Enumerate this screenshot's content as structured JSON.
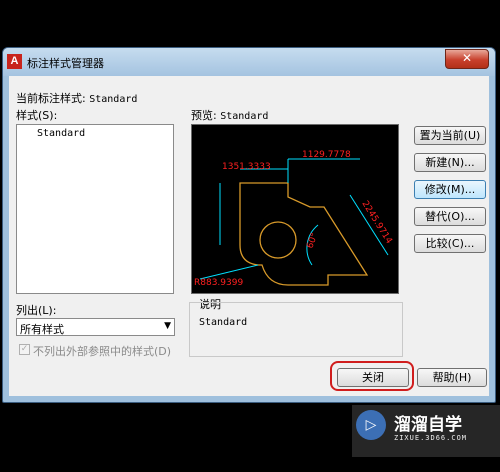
{
  "window": {
    "title": "标注样式管理器",
    "app_icon_letter": "A",
    "close_glyph": "✕"
  },
  "current_style": {
    "label": "当前标注样式:",
    "value": "Standard"
  },
  "styles_label": "样式(S):",
  "styles_list": [
    "Standard"
  ],
  "list_label": "列出(L):",
  "list_filter": {
    "selected": "所有样式"
  },
  "xref_checkbox": {
    "label": "不列出外部参照中的样式(D)",
    "checked": true,
    "disabled": true
  },
  "preview": {
    "label": "预览:",
    "style": "Standard",
    "dims": [
      "1351.3333",
      "1129.7778",
      "2245.9714",
      "R883.9399",
      "60°"
    ]
  },
  "description": {
    "label": "说明",
    "text": "Standard"
  },
  "buttons": {
    "set_current": "置为当前(U)",
    "new": "新建(N)...",
    "modify": "修改(M)...",
    "override": "替代(O)...",
    "compare": "比较(C)...",
    "close": "关闭",
    "help": "帮助(H)"
  },
  "watermark": {
    "name": "溜溜自学",
    "url": "ZIXUE.3D66.COM",
    "logo_glyph": "▷"
  },
  "colors": {
    "preview_bg": "#000000",
    "dim_red": "#ff2020",
    "dim_cyan": "#00e0ff",
    "part_outline": "#d89a2a",
    "highlight": "#d01d1d"
  }
}
